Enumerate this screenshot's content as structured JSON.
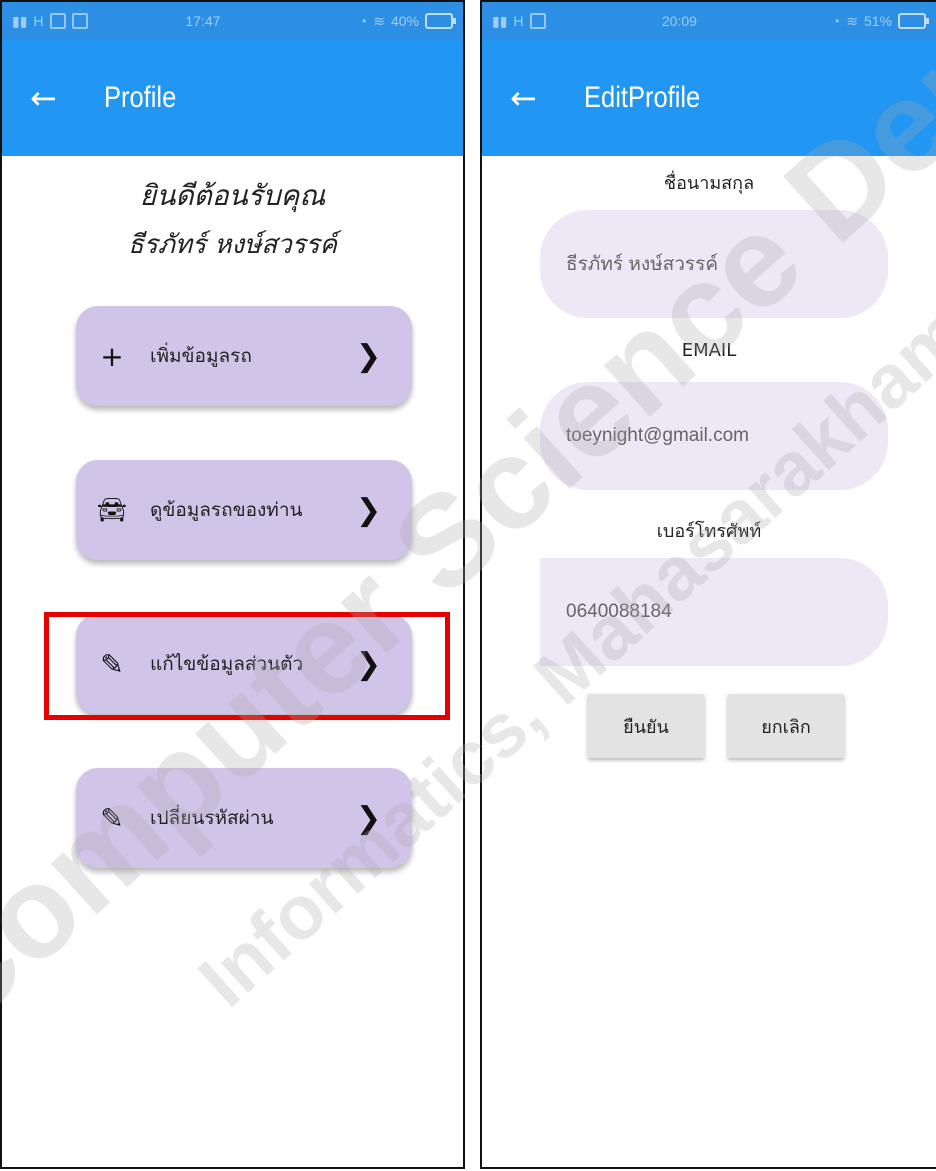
{
  "left_screen": {
    "status": {
      "carrier": "H",
      "time": "17:47",
      "battery": "40%"
    },
    "appbar": {
      "back_icon": "arrow-left-icon",
      "title": "Profile"
    },
    "welcome": {
      "line1": "ยินดีต้อนรับคุณ",
      "line2": "ธีรภัทร์ หงษ์สวรรค์"
    },
    "menu": [
      {
        "icon": "plus-icon",
        "label": "เพิ่มข้อมูลรถ"
      },
      {
        "icon": "car-icon",
        "label": "ดูข้อมูลรถของท่าน"
      },
      {
        "icon": "pencil-icon",
        "label": "แก้ไขข้อมูลส่วนตัว"
      },
      {
        "icon": "pencil-icon",
        "label": "เปลี่ยนรหัสผ่าน"
      }
    ],
    "highlight_color": "#e60000"
  },
  "right_screen": {
    "status": {
      "carrier": "H",
      "time": "20:09",
      "battery": "51%"
    },
    "appbar": {
      "back_icon": "arrow-left-icon",
      "title": "EditProfile"
    },
    "fields": [
      {
        "label": "ชื่อนามสกุล",
        "value": "ธีรภัทร์ หงษ์สวรรค์"
      },
      {
        "label": "EMAIL",
        "value": "toeynight@gmail.com"
      },
      {
        "label": "เบอร์โทรศัพท์",
        "value": "0640088184"
      }
    ],
    "buttons": {
      "confirm": "ยืนยัน",
      "cancel": "ยกเลิก"
    }
  },
  "colors": {
    "appbar": "#2196f3",
    "statusbar": "#2c8fe3",
    "menu_button": "#d1c4e9",
    "field_bg": "#ede7f6"
  },
  "watermark": {
    "line1": "Computer Science Department",
    "line2": "Informatics, Mahasarakham University"
  }
}
